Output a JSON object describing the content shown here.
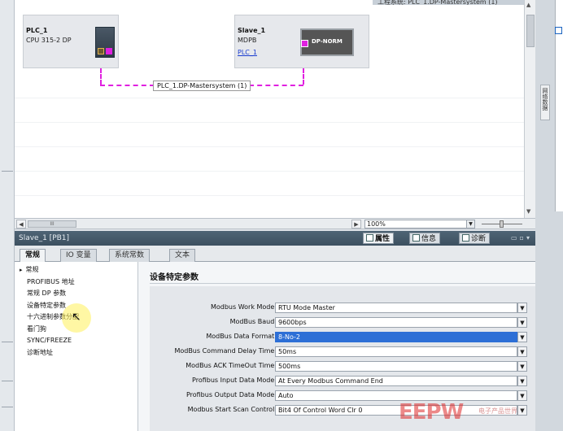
{
  "network": {
    "title_bar": "工程系统: PLC_1.DP-Mastersystem (1)",
    "plc": {
      "name": "PLC_1",
      "type": "CPU 315-2 DP"
    },
    "slave": {
      "name": "Slave_1",
      "type": "MDPB",
      "link": "PLC_1",
      "module_label": "DP-NORM"
    },
    "bus_label": "PLC_1.DP-Mastersystem (1)",
    "zoom_value": "100%",
    "hscroll_thumb": "III"
  },
  "right_strip": {
    "vertical_tab": "网络数据"
  },
  "properties": {
    "title": "Slave_1 [PB1]",
    "header_tabs": [
      {
        "label": "属性",
        "icon": "properties-icon"
      },
      {
        "label": "信息",
        "icon": "info-icon"
      },
      {
        "label": "诊断",
        "icon": "diagnostics-icon"
      }
    ],
    "tabs": [
      "常规",
      "IO 变量",
      "系统常数",
      "文本"
    ],
    "nav": [
      {
        "label": "常规",
        "parent": true
      },
      {
        "label": "PROFIBUS 地址",
        "parent": false
      },
      {
        "label": "常规 DP 参数",
        "parent": false
      },
      {
        "label": "设备特定参数",
        "parent": false
      },
      {
        "label": "十六进制参数分配",
        "parent": false
      },
      {
        "label": "看门狗",
        "parent": false
      },
      {
        "label": "SYNC/FREEZE",
        "parent": false
      },
      {
        "label": "诊断地址",
        "parent": false
      }
    ],
    "section_title": "设备特定参数",
    "params": [
      {
        "label": "Modbus Work Mode:",
        "value": "RTU Mode Master"
      },
      {
        "label": "ModBus Baud:",
        "value": "9600bps"
      },
      {
        "label": "ModBus Data Format:",
        "value": "8-No-2",
        "selected": true
      },
      {
        "label": "ModBus Command Delay Time:",
        "value": "50ms"
      },
      {
        "label": "ModBus ACK TimeOut Time:",
        "value": "500ms"
      },
      {
        "label": "Profibus Input Data Mode:",
        "value": "At Every Modbus Command End"
      },
      {
        "label": "Profibus Output Data Mode:",
        "value": "Auto"
      },
      {
        "label": "Modbus Start Scan Control:",
        "value": "Bit4 Of Control Word Clr 0"
      }
    ]
  },
  "watermark": {
    "logo": "EEPW",
    "sub": "电子产品世界"
  }
}
